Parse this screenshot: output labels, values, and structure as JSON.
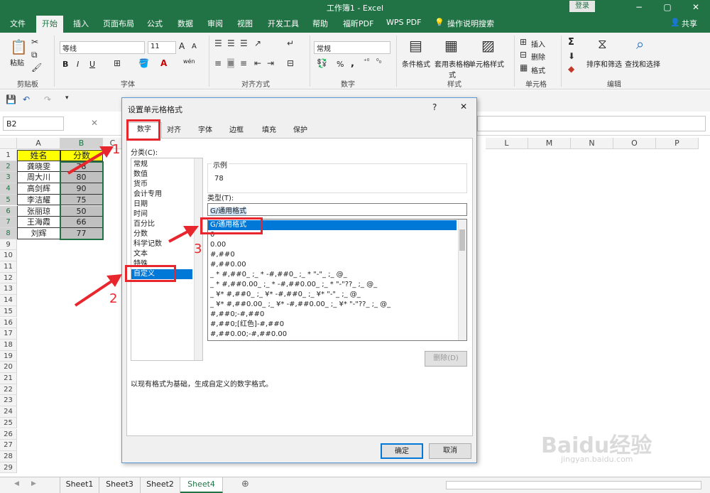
{
  "window": {
    "title": "工作簿1 - Excel",
    "login": "登录",
    "min": "−",
    "restore": "▢",
    "close": "✕"
  },
  "ribbon_tabs": [
    "文件",
    "开始",
    "插入",
    "页面布局",
    "公式",
    "数据",
    "审阅",
    "视图",
    "开发工具",
    "帮助",
    "福昕PDF",
    "WPS PDF"
  ],
  "tell_me": "操作说明搜索",
  "share": "共享",
  "ribbon": {
    "clipboard": {
      "paste": "粘贴",
      "label": "剪贴板"
    },
    "font": {
      "name": "等线",
      "size": "11",
      "grow": "A",
      "shrink": "A",
      "bold": "B",
      "italic": "I",
      "underline": "U",
      "wen": "wén",
      "label": "字体"
    },
    "align": {
      "label": "对齐方式"
    },
    "number": {
      "format": "常规",
      "pct": "%",
      "comma": ",",
      "label": "数字"
    },
    "styles": {
      "cond": "条件格式",
      "table": "套用表格格式",
      "cell": "单元格样式",
      "label": "样式"
    },
    "cells": {
      "insert": "插入",
      "delete": "删除",
      "format": "格式",
      "label": "单元格"
    },
    "editing": {
      "sum": "Σ",
      "sort": "排序和筛选",
      "find": "查找和选择",
      "label": "编辑"
    }
  },
  "namebox": "B2",
  "fx": "✕",
  "columns": [
    "A",
    "B",
    "C",
    "L",
    "M",
    "N",
    "O",
    "P"
  ],
  "rows": [
    "1",
    "2",
    "3",
    "4",
    "5",
    "6",
    "7",
    "8",
    "9",
    "10",
    "11",
    "12",
    "13",
    "14",
    "15",
    "16",
    "17",
    "18",
    "19",
    "20",
    "21",
    "22",
    "23",
    "24",
    "25",
    "26",
    "27",
    "28",
    "29"
  ],
  "table": {
    "header": [
      "姓名",
      "分数"
    ],
    "data": [
      [
        "龚晓雯",
        "78"
      ],
      [
        "周大川",
        "80"
      ],
      [
        "高剑辉",
        "90"
      ],
      [
        "李洁耀",
        "75"
      ],
      [
        "张丽琼",
        "50"
      ],
      [
        "王海霞",
        "66"
      ],
      [
        "刘辉",
        "77"
      ]
    ]
  },
  "sheets": [
    "Sheet1",
    "Sheet3",
    "Sheet2",
    "Sheet4"
  ],
  "dialog": {
    "title": "设置单元格格式",
    "help": "?",
    "close": "✕",
    "tabs": [
      "数字",
      "对齐",
      "字体",
      "边框",
      "填充",
      "保护"
    ],
    "category_label": "分类(C):",
    "categories": [
      "常规",
      "数值",
      "货币",
      "会计专用",
      "日期",
      "时间",
      "百分比",
      "分数",
      "科学记数",
      "文本",
      "特殊",
      "自定义"
    ],
    "sample_label": "示例",
    "sample_value": "78",
    "type_label": "类型(T):",
    "type_value": "G/通用格式",
    "formats": [
      "G/通用格式",
      "0",
      "0.00",
      "#,##0",
      "#,##0.00",
      "_ * #,##0_ ;_ * -#,##0_ ;_ * \"-\"_ ;_ @_",
      "_ * #,##0.00_ ;_ * -#,##0.00_ ;_ * \"-\"??_ ;_ @_",
      "_ ¥* #,##0_ ;_ ¥* -#,##0_ ;_ ¥* \"-\"_ ;_ @_",
      "_ ¥* #,##0.00_ ;_ ¥* -#,##0.00_ ;_ ¥* \"-\"??_ ;_ @_",
      "#,##0;-#,##0",
      "#,##0;[红色]-#,##0",
      "#,##0.00;-#,##0.00"
    ],
    "delete": "删除(D)",
    "description": "以现有格式为基础，生成自定义的数字格式。",
    "ok": "确定",
    "cancel": "取消"
  },
  "annotations": [
    "1",
    "2",
    "3"
  ],
  "watermark": "Baidu经验",
  "watermark_url": "jingyan.baidu.com",
  "colors": {
    "excel_green": "#217346",
    "header_fill": "#ffff00",
    "score_fill": "#c0c0c0",
    "highlight": "#e8262d",
    "select": "#0078d7"
  }
}
